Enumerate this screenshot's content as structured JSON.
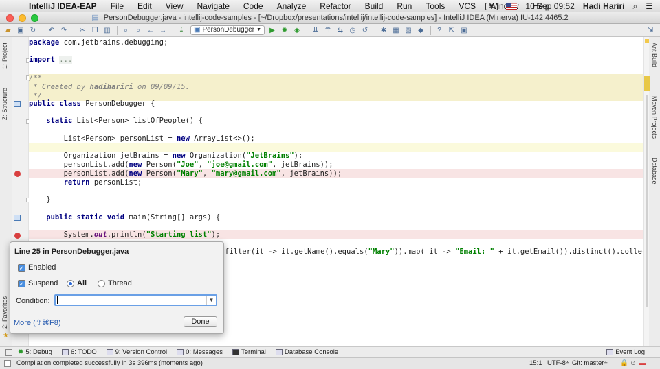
{
  "menubar": {
    "app_name": "IntelliJ IDEA-EAP",
    "items": [
      "File",
      "Edit",
      "View",
      "Navigate",
      "Code",
      "Analyze",
      "Refactor",
      "Build",
      "Run",
      "Tools",
      "VCS",
      "Window",
      "Help"
    ],
    "battery": "99",
    "datetime": "10 Sep  09:52",
    "user": "Hadi Hariri"
  },
  "window": {
    "title": "PersonDebugger.java - intellij-code-samples - [~/Dropbox/presentations/intellij/intellij-code-samples] - IntelliJ IDEA (Minerva) IU-142.4465.2"
  },
  "toolbar": {
    "run_config": "PersonDebugger"
  },
  "side_tabs": {
    "left": [
      "1: Project",
      "Z: Structure",
      "2: Favorites"
    ],
    "right": [
      "Ant Build",
      "Maven Projects",
      "Database"
    ]
  },
  "code": {
    "l1_a": "package ",
    "l1_b": "com.jetbrains.debugging;",
    "l2_a": "import ",
    "l2_b": "...",
    "l3": "/**",
    "l4_a": " * Created by ",
    "l4_b": "hadihariri",
    "l4_c": " on 09/09/15.",
    "l5": " */",
    "l6_a": "public class ",
    "l6_b": "PersonDebugger {",
    "l7_a": "    static ",
    "l7_b": "List<Person> listOfPeople() {",
    "l8_a": "        List<Person> personList = ",
    "l8_b": "new ",
    "l8_c": "ArrayList<>();",
    "l9_a": "        Organization jetBrains = ",
    "l9_b": "new ",
    "l9_c": "Organization(",
    "l9_d": "\"JetBrains\"",
    "l9_e": ");",
    "l10_a": "        personList.add(",
    "l10_b": "new ",
    "l10_c": "Person(",
    "l10_d": "\"Joe\"",
    "l10_e": ", ",
    "l10_f": "\"joe@gmail.com\"",
    "l10_g": ", jetBrains));",
    "l11_a": "        personList.add(",
    "l11_b": "new ",
    "l11_c": "Person(",
    "l11_d": "\"Mary\"",
    "l11_e": ", ",
    "l11_f": "\"mary@gmail.com\"",
    "l11_g": ", jetBrains));",
    "l12_a": "        return ",
    "l12_b": "personList;",
    "l13": "    }",
    "l14_a": "    public static void ",
    "l14_b": "main(String[] args) {",
    "l15_a": "        System.",
    "l15_b": "out",
    "l15_c": ".println(",
    "l15_d": "\"Starting list\"",
    "l15_e": ");",
    "l16_a": "filter(it -> it.getName().equals(",
    "l16_b": "\"Mary\"",
    "l16_c": ")).map( it -> ",
    "l16_d": "\"Email: \"",
    "l16_e": " + it.getEmail()).distinct().collect(Colle"
  },
  "breakpoint_popup": {
    "title": "Line 25 in PersonDebugger.java",
    "enabled_label": "Enabled",
    "suspend_label": "Suspend",
    "all_label": "All",
    "thread_label": "Thread",
    "condition_label": "Condition:",
    "condition_value": "",
    "more_label": "More (⇧⌘F8)",
    "done_label": "Done"
  },
  "tool_windows": [
    {
      "label": "5: Debug"
    },
    {
      "label": "6: TODO"
    },
    {
      "label": "9: Version Control"
    },
    {
      "label": "0: Messages"
    },
    {
      "label": "Terminal"
    },
    {
      "label": "Database Console"
    }
  ],
  "event_log": "Event Log",
  "status": {
    "message": "Compilation completed successfully in 3s 396ms (moments ago)",
    "position": "15:1",
    "encoding": "UTF-8÷",
    "git": "Git: master÷"
  },
  "colors": {
    "breakpoint": "#d94040",
    "keyword": "#000080",
    "string": "#008000",
    "comment_bg": "#f5f0cc"
  }
}
